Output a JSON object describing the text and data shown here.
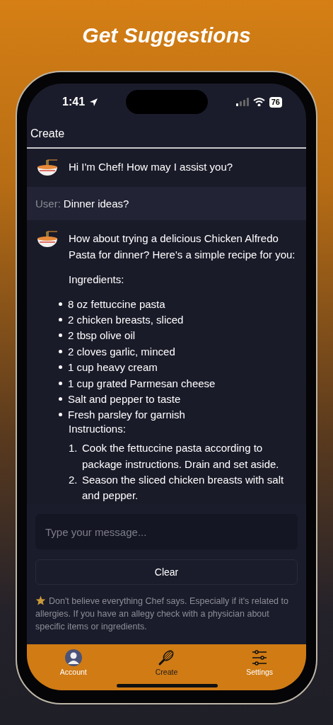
{
  "heading": "Get Suggestions",
  "status_bar": {
    "time": "1:41",
    "battery": "76"
  },
  "header": {
    "title": "Create"
  },
  "messages": [
    {
      "kind": "bot",
      "blocks": [
        {
          "kind": "paragraph",
          "text": "Hi I'm Chef! How may I assist you?"
        }
      ]
    },
    {
      "kind": "user",
      "speaker": "User:",
      "text": "Dinner ideas?"
    },
    {
      "kind": "bot",
      "blocks": [
        {
          "kind": "paragraph",
          "text": "How about trying a delicious Chicken Alfredo Pasta for dinner? Here's a simple recipe for you:"
        },
        {
          "kind": "paragraph",
          "text": "Ingredients:"
        },
        {
          "kind": "bullets",
          "items": [
            "8 oz fettuccine pasta",
            "2 chicken breasts, sliced",
            "2 tbsp olive oil",
            "2 cloves garlic, minced",
            "1 cup heavy cream",
            "1 cup grated Parmesan cheese",
            "Salt and pepper to taste",
            "Fresh parsley for garnish"
          ]
        },
        {
          "kind": "label",
          "text": "Instructions:"
        },
        {
          "kind": "numbered",
          "items": [
            {
              "number": "1.",
              "text": "Cook the fettuccine pasta according to package instructions. Drain and set aside."
            },
            {
              "number": "2.",
              "text": "Season the sliced chicken breasts with salt and pepper."
            }
          ]
        }
      ]
    }
  ],
  "composer": {
    "placeholder": "Type your message...",
    "button": "Clear"
  },
  "disclaimer": "Don't believe everything Chef says. Especially if it's related to allergies. If you have an allegy check with a physician about specific items or ingredients.",
  "tabs": [
    {
      "kind": "account",
      "label": "Account",
      "selected": false
    },
    {
      "kind": "create",
      "label": "Create",
      "selected": true
    },
    {
      "kind": "settings",
      "label": "Settings",
      "selected": false
    }
  ]
}
